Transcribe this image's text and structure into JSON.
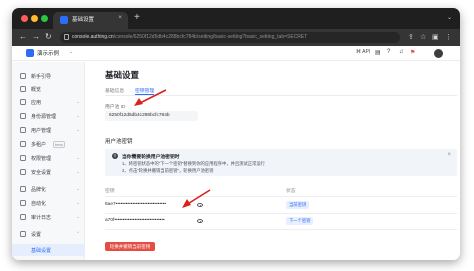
{
  "browser": {
    "tab_title": "基础设置",
    "tab_close": "×",
    "new_tab": "+",
    "menu_chevron": "⌄",
    "url_host": "console.authing.cn",
    "url_path": "/console/6250f12d5db4c288bcfc784b/setting/basic-setting?basic_setting_tab=SECRET"
  },
  "header": {
    "workspace_name": "演示示例",
    "api_label": "API"
  },
  "sidebar": {
    "items": [
      {
        "label": "新手引导",
        "chevron": ""
      },
      {
        "label": "概览",
        "chevron": ""
      },
      {
        "label": "应用",
        "chevron": "⌄"
      },
      {
        "label": "身份源管理",
        "chevron": "⌄"
      },
      {
        "label": "用户管理",
        "chevron": "⌄"
      },
      {
        "label": "多租户",
        "badge": "beta",
        "chevron": ""
      },
      {
        "label": "权限管理",
        "chevron": "⌄"
      },
      {
        "label": "安全设置",
        "chevron": "⌄"
      },
      {
        "label": "品牌化",
        "chevron": "⌄"
      },
      {
        "label": "自动化",
        "chevron": "⌄"
      },
      {
        "label": "审计日志",
        "chevron": "⌄"
      },
      {
        "label": "设置",
        "chevron": "⌃"
      },
      {
        "label": "基础设置",
        "chevron": ""
      }
    ]
  },
  "main": {
    "title": "基础设置",
    "tabs": [
      {
        "label": "基础信息",
        "active": false
      },
      {
        "label": "密钥管理",
        "active": true
      }
    ],
    "pool_id_label": "用户池 ID",
    "pool_id_value": "6250f12d5db4c288bcfc784b",
    "secret_section_title": "用户池密钥",
    "alert": {
      "icon": "!",
      "title": "当你需要轮换用户池密钥时",
      "line1": "1、将密钥状态中的\"下一个密钥\"替换到你的应用程序中，并且测试正常运行",
      "line2": "2、点击\"轮换并撤销当前密钥\"，轮换用户池密钥",
      "close": "×"
    },
    "columns": {
      "secret": "密钥",
      "status": "状态"
    },
    "rows": [
      {
        "secret": "6ae7••••••••••••••••••••••••••••••",
        "status": "当前密钥"
      },
      {
        "secret": "a70f••••••••••••••••••••••••••••••",
        "status": "下一个密钥"
      }
    ],
    "rotate_button": "轮换并撤销当前密钥"
  },
  "colors": {
    "accent": "#2d6cf6",
    "danger": "#e34d43",
    "annotation_arrow": "#d9221b"
  }
}
